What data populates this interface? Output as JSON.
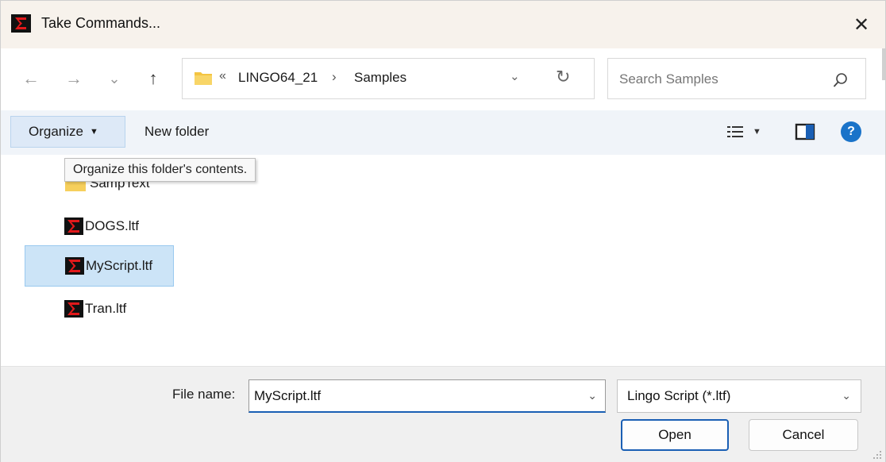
{
  "window": {
    "title": "Take Commands...",
    "close_glyph": "✕",
    "app_icon": "lingo-sigma-icon"
  },
  "nav": {
    "back_glyph": "←",
    "forward_glyph": "→",
    "recent_glyph": "⌄",
    "up_glyph": "↑"
  },
  "address": {
    "overflow_glyph": "«",
    "crumbs": [
      "LINGO64_21",
      "Samples"
    ],
    "separator": "›",
    "dropdown_glyph": "⌄",
    "refresh_glyph": "↻"
  },
  "search": {
    "placeholder": "Search Samples"
  },
  "toolbar": {
    "organize_label": "Organize",
    "organize_caret": "▼",
    "new_folder_label": "New folder",
    "view_caret": "▼",
    "help_glyph": "?"
  },
  "tooltip": {
    "text": "Organize this folder's contents."
  },
  "files": [
    {
      "name": "SampText",
      "type": "folder",
      "selected": false
    },
    {
      "name": "DOGS.ltf",
      "type": "file",
      "selected": false
    },
    {
      "name": "MyScript.ltf",
      "type": "file",
      "selected": true
    },
    {
      "name": "Tran.ltf",
      "type": "file",
      "selected": false
    }
  ],
  "bottom": {
    "file_name_label": "File name:",
    "file_name_value": "MyScript.ltf",
    "file_name_dd": "⌄",
    "file_type_value": "Lingo Script (*.ltf)",
    "file_type_dd": "⌄",
    "open_label": "Open",
    "cancel_label": "Cancel"
  },
  "colors": {
    "accent": "#1a5fb4",
    "selection": "#cce4f7",
    "titlebar": "#f7f2ec",
    "toolbar": "#f0f4f9",
    "folder": "#f4c441",
    "icon_red": "#e0191b"
  }
}
